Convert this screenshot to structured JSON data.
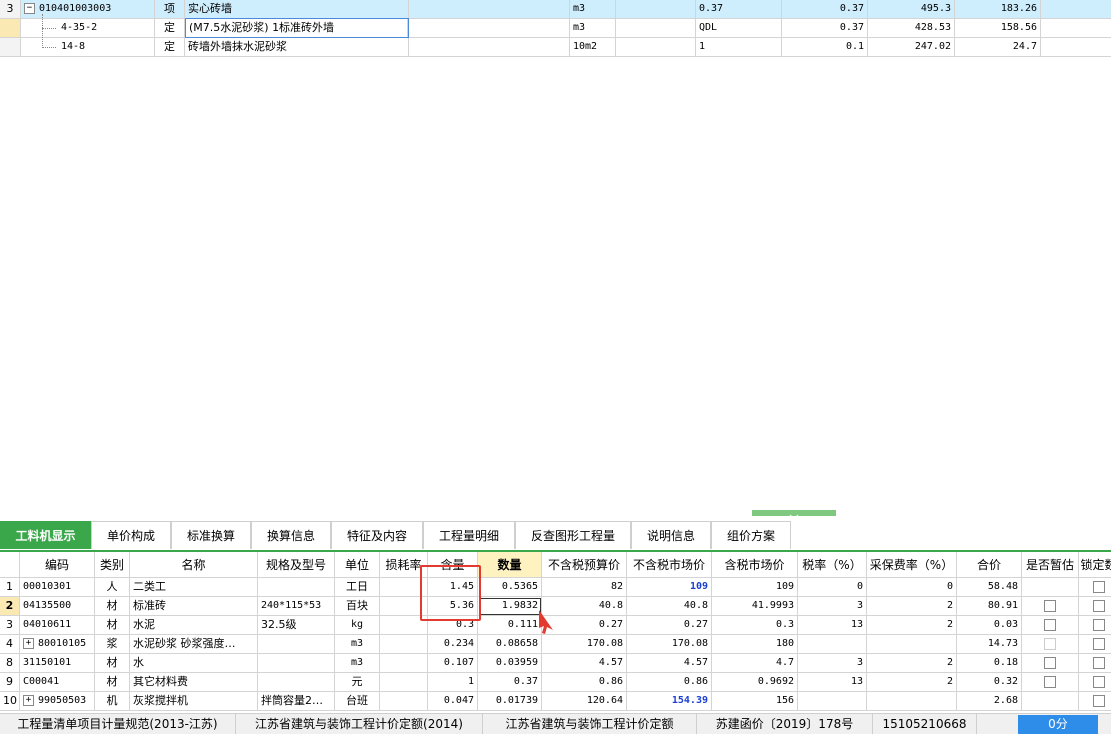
{
  "upper_rows": [
    {
      "no": "3",
      "code": "010401003003",
      "type": "项",
      "name": "实心砖墙",
      "unit": "m3",
      "qty_expr": "0.37",
      "qty": "0.37",
      "unit_price": "495.3",
      "total": "183.26"
    },
    {
      "no": "",
      "code": "4-35-2",
      "type": "定",
      "name": "(M7.5水泥砂浆) 1标准砖外墙",
      "unit": "m3",
      "qty_expr": "QDL",
      "qty": "0.37",
      "unit_price": "428.53",
      "total": "158.56"
    },
    {
      "no": "",
      "code": "14-8",
      "type": "定",
      "name": "砖墙外墙抹水泥砂浆",
      "unit": "10m2",
      "qty_expr": "1",
      "qty": "0.1",
      "unit_price": "247.02",
      "total": "24.7"
    }
  ],
  "tabs": [
    "工料机显示",
    "单价构成",
    "标准换算",
    "换算信息",
    "特征及内容",
    "工程量明细",
    "反查图形工程量",
    "说明信息",
    "组价方案"
  ],
  "headers": [
    "编码",
    "类别",
    "名称",
    "规格及型号",
    "单位",
    "损耗率",
    "含量",
    "数量",
    "不含税预算价",
    "不含税市场价",
    "含税市场价",
    "税率（%）",
    "采保费率（%）",
    "合价",
    "是否暂估",
    "锁定数"
  ],
  "rows": [
    {
      "no": "1",
      "code": "00010301",
      "cat": "人",
      "name": "二类工",
      "spec": "",
      "unit": "工日",
      "loss": "",
      "content": "1.45",
      "qty": "0.5365",
      "budget": "82",
      "market": "109",
      "market_tax": "109",
      "tax": "0",
      "fee": "0",
      "total": "58.48",
      "check": ""
    },
    {
      "no": "2",
      "code": "04135500",
      "cat": "材",
      "name": "标准砖",
      "spec": "240*115*53",
      "unit": "百块",
      "loss": "",
      "content": "5.36",
      "qty": "1.9832",
      "budget": "40.8",
      "market": "40.8",
      "market_tax": "41.9993",
      "tax": "3",
      "fee": "2",
      "total": "80.91",
      "check": "box"
    },
    {
      "no": "3",
      "code": "04010611",
      "cat": "材",
      "name": "水泥",
      "spec": "32.5级",
      "unit": "kg",
      "loss": "",
      "content": "0.3",
      "qty": "0.111",
      "budget": "0.27",
      "market": "0.27",
      "market_tax": "0.3",
      "tax": "13",
      "fee": "2",
      "total": "0.03",
      "check": "box"
    },
    {
      "no": "4",
      "code": "80010105",
      "cat": "浆",
      "name": "水泥砂浆 砂浆强度…",
      "spec": "",
      "unit": "m3",
      "loss": "",
      "content": "0.234",
      "qty": "0.08658",
      "budget": "170.08",
      "market": "170.08",
      "market_tax": "180",
      "tax": "",
      "fee": "",
      "total": "14.73",
      "check": "dis"
    },
    {
      "no": "8",
      "code": "31150101",
      "cat": "材",
      "name": "水",
      "spec": "",
      "unit": "m3",
      "loss": "",
      "content": "0.107",
      "qty": "0.03959",
      "budget": "4.57",
      "market": "4.57",
      "market_tax": "4.7",
      "tax": "3",
      "fee": "2",
      "total": "0.18",
      "check": "box"
    },
    {
      "no": "9",
      "code": "C00041",
      "cat": "材",
      "name": "其它材料费",
      "spec": "",
      "unit": "元",
      "loss": "",
      "content": "1",
      "qty": "0.37",
      "budget": "0.86",
      "market": "0.86",
      "market_tax": "0.9692",
      "tax": "13",
      "fee": "2",
      "total": "0.32",
      "check": "box"
    },
    {
      "no": "10",
      "code": "99050503",
      "cat": "机",
      "name": "灰浆搅拌机",
      "spec": "拌筒容量2…",
      "unit": "台班",
      "loss": "",
      "content": "0.047",
      "qty": "0.01739",
      "budget": "120.64",
      "market": "154.39",
      "market_tax": "156",
      "tax": "",
      "fee": "",
      "total": "2.68",
      "check": "box"
    }
  ],
  "status": [
    "工程量清单项目计量规范(2013-江苏)",
    "江苏省建筑与装饰工程计价定额(2014)",
    "江苏省建筑与装饰工程计价定额",
    "苏建函价〔2019〕178号",
    "15105210668"
  ],
  "score": "0分",
  "colors": {
    "accent_green": "#3aa84a",
    "selected_row": "#cfeefd",
    "highlight_blue": "#1a3fd1",
    "annotation_red": "#e23a2e",
    "score_blue": "#2f8dea"
  }
}
